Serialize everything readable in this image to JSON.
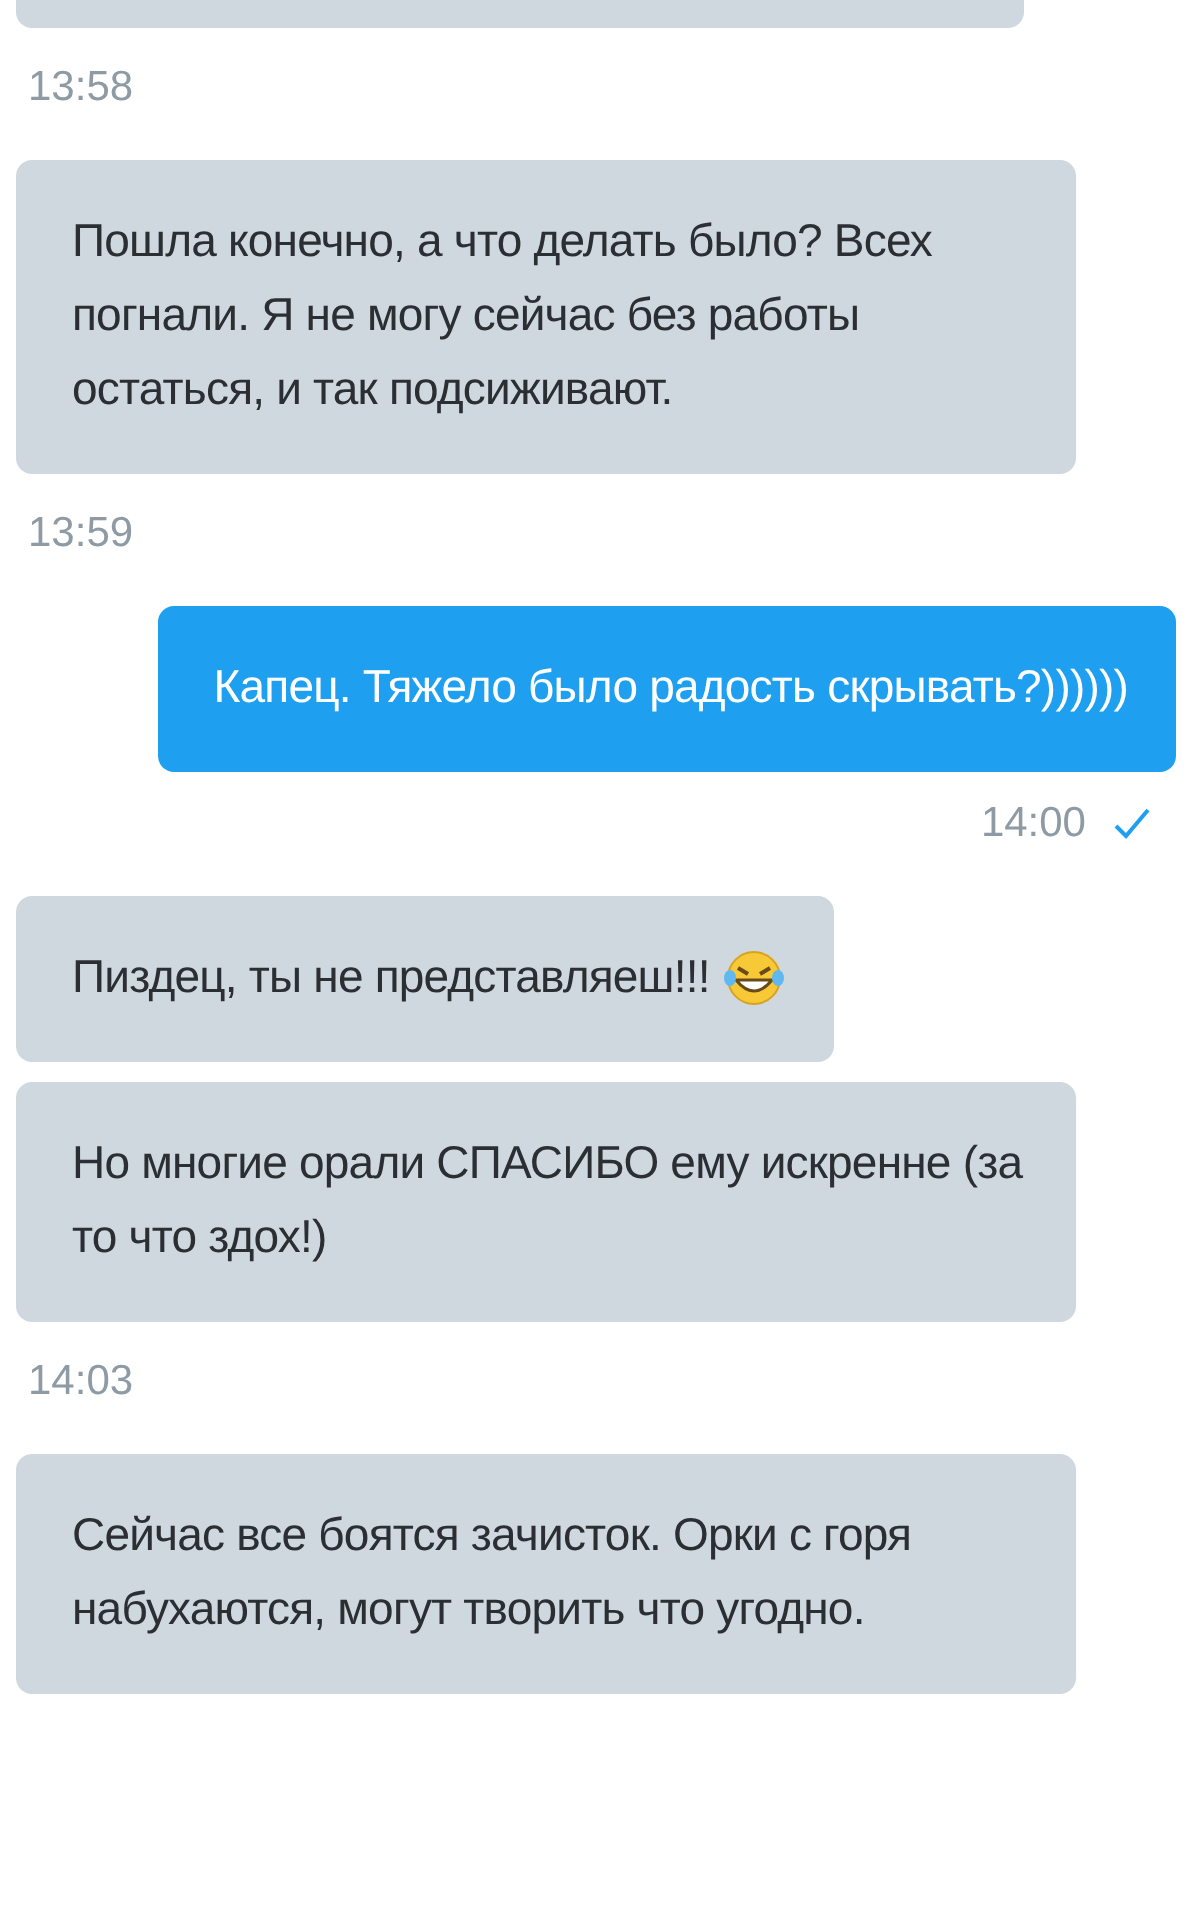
{
  "items": [
    {
      "kind": "incoming",
      "cut": true
    },
    {
      "kind": "stamp",
      "text": "13:58"
    },
    {
      "kind": "incoming",
      "text": "Пошла конечно, а что делать было? Всех погнали. Я не могу сейчас без работы остаться, и так подсиживают."
    },
    {
      "kind": "stamp",
      "text": "13:59"
    },
    {
      "kind": "outgoing",
      "text": "Капец. Тяжело было радость скрывать?))))))"
    },
    {
      "kind": "sentstamp",
      "text": "14:00",
      "read": true
    },
    {
      "kind": "incoming",
      "text": "Пиздец, ты не представляеш!!!",
      "emoji": true
    },
    {
      "kind": "incoming",
      "text": "Но многие орали СПАСИБО ему искренне (за то что здох!)"
    },
    {
      "kind": "stamp",
      "text": "14:03"
    },
    {
      "kind": "incoming",
      "text": "Сейчас все боятся зачисток. Орки с горя набухаются, могут творить что угодно."
    }
  ]
}
